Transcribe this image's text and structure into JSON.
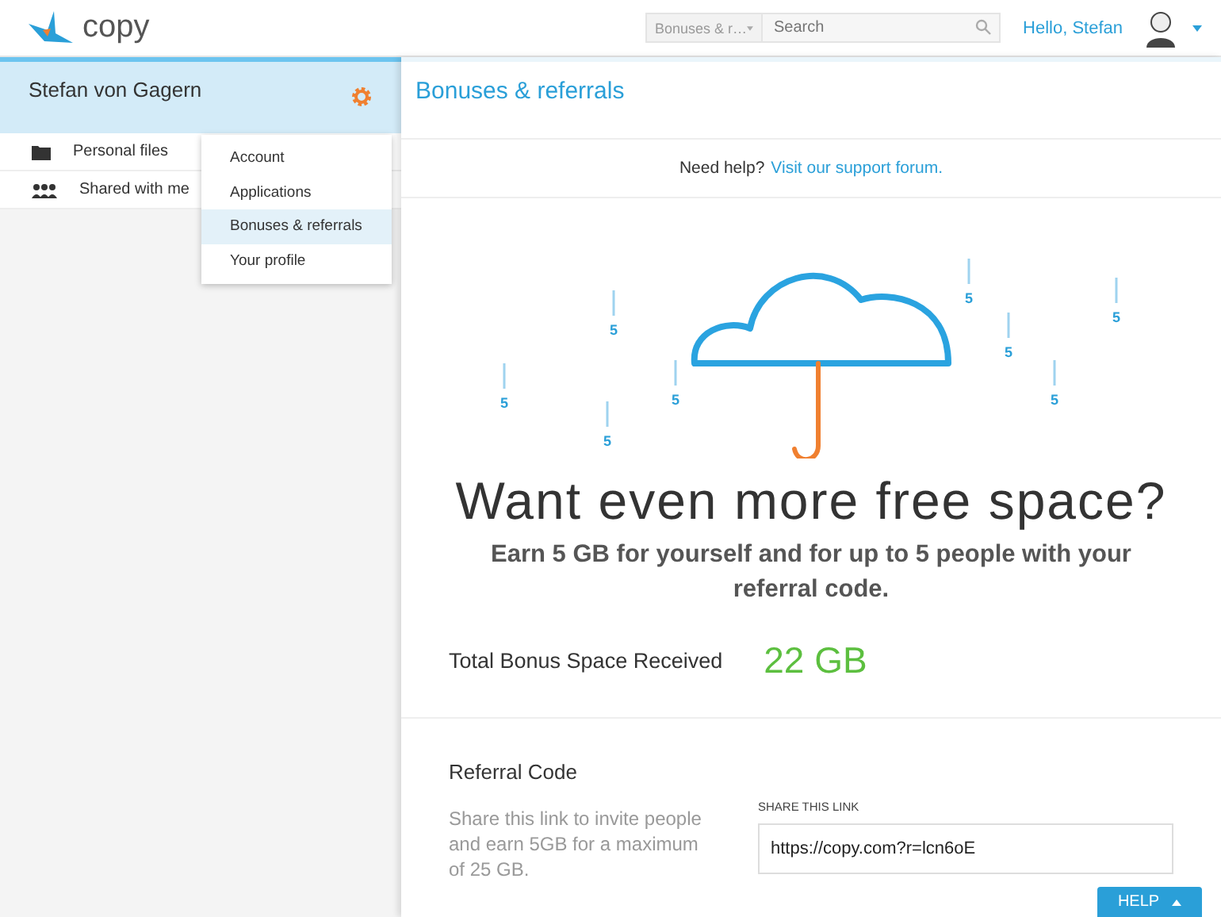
{
  "header": {
    "logo": "copy",
    "scope_select": "Bonuses & r…",
    "search": {
      "placeholder": "Search"
    },
    "greeting": "Hello, Stefan"
  },
  "sidebar": {
    "user_name": "Stefan von Gagern",
    "items": [
      {
        "label": "Personal files",
        "kind": "folder"
      },
      {
        "label": "Shared with me",
        "kind": "shared"
      }
    ]
  },
  "menu": [
    {
      "label": "Account",
      "selected": false
    },
    {
      "label": "Applications",
      "selected": false
    },
    {
      "label": "Bonuses & referrals",
      "selected": true
    },
    {
      "label": "Your profile",
      "selected": false
    }
  ],
  "page": {
    "title": "Bonuses & referrals",
    "help_text": "Need help?",
    "help_link": "Visit our support forum.",
    "drops": [
      "5",
      "5",
      "5",
      "5",
      "5",
      "5",
      "5",
      "5"
    ],
    "headline": "Want even more free space?",
    "subline": "Earn 5 GB for yourself and for up to 5 people with your referral code.",
    "bonus_label": "Total Bonus Space Received",
    "bonus_value": "22 GB",
    "referral_title": "Referral Code",
    "referral_text": "Share this link to invite people and earn 5GB for a maximum of 25 GB.",
    "link_label": "SHARE THIS LINK",
    "link_value": "https://copy.com?r=lcn6oE"
  },
  "help_button": "HELP"
}
